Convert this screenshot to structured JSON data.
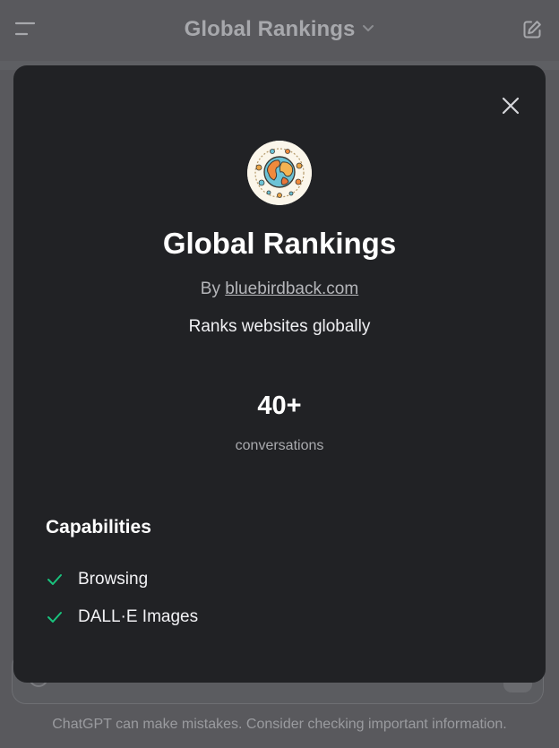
{
  "topbar": {
    "title": "Global Rankings",
    "menu_icon": "hamburger-icon",
    "compose_icon": "edit-icon",
    "title_dropdown_icon": "chevron-down-icon"
  },
  "modal": {
    "close_icon": "close-icon",
    "avatar_icon": "globe-icon",
    "title": "Global Rankings",
    "by_prefix": "By",
    "author_link": "bluebirdback.com",
    "description": "Ranks websites globally",
    "stat_value": "40+",
    "stat_label": "conversations",
    "capabilities_heading": "Capabilities",
    "capabilities": [
      {
        "label": "Browsing",
        "icon": "check-icon"
      },
      {
        "label": "DALL·E Images",
        "icon": "check-icon"
      }
    ]
  },
  "footer": {
    "disclaimer": "ChatGPT can make mistakes. Consider checking important information."
  },
  "colors": {
    "backdrop": "#59595d",
    "modal_bg": "#212225",
    "check_green": "#19c37d",
    "text_primary": "#ffffff",
    "text_muted": "#a9aaae"
  }
}
